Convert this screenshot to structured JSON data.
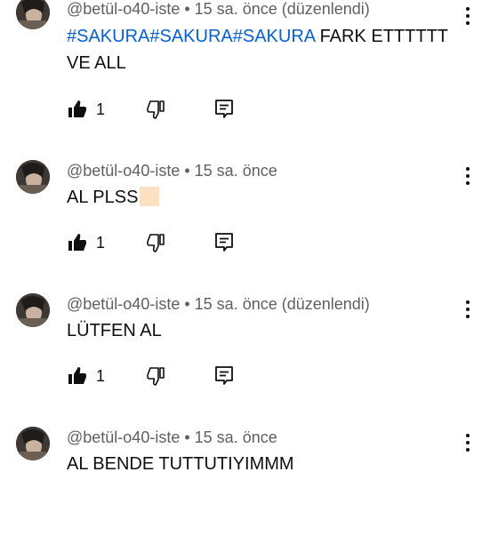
{
  "comments": [
    {
      "author": "@betül-o40-iste",
      "sep": "•",
      "time": "15 sa. önce (düzenlendi)",
      "tags": [
        "#SAKURA",
        "#SAKURA",
        "#SAKURA"
      ],
      "text": " FARK ETTTTTT VE ALL",
      "likes": "1"
    },
    {
      "author": "@betül-o40-iste",
      "sep": "•",
      "time": "15 sa. önce",
      "text": "AL PLSS",
      "likes": "1"
    },
    {
      "author": "@betül-o40-iste",
      "sep": "•",
      "time": "15 sa. önce (düzenlendi)",
      "text": "LÜTFEN AL",
      "likes": "1"
    },
    {
      "author": "@betül-o40-iste",
      "sep": "•",
      "time": "15 sa. önce",
      "text": "AL BENDE TUTTUTIYIMMM"
    }
  ],
  "icons": {
    "like": "thumb-up-filled-icon",
    "dislike": "thumb-down-outline-icon",
    "reply": "comment-reply-icon",
    "menu": "more-vert-icon"
  },
  "colors": {
    "hashtag": "#065fd4",
    "meta": "#606060",
    "text": "#0f0f0f"
  }
}
